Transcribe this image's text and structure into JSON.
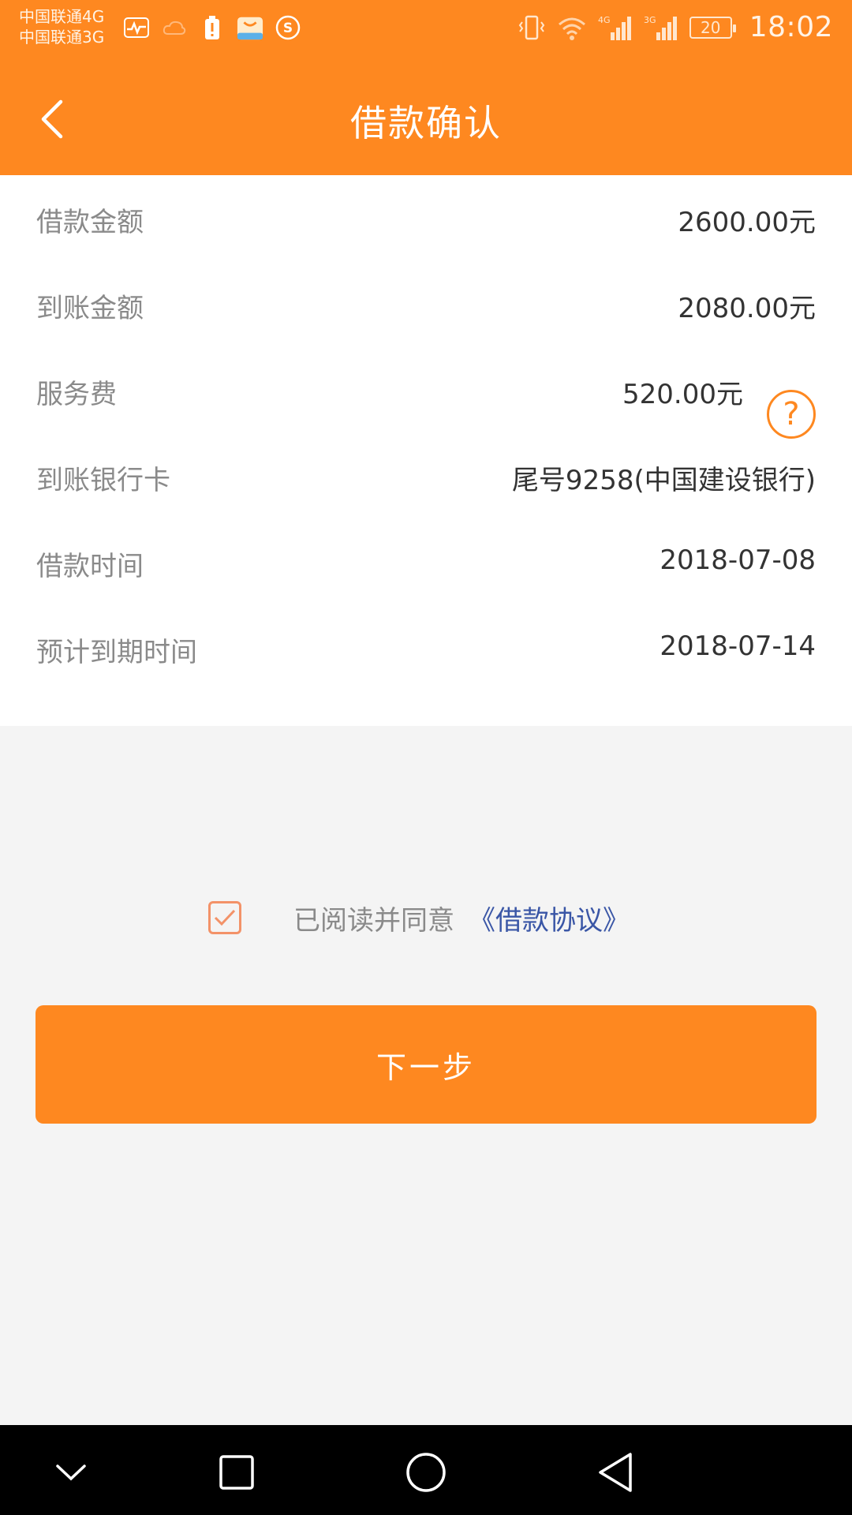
{
  "status_bar": {
    "carrier_line1": "中国联通4G",
    "carrier_line2": "中国联通3G",
    "network1": "4G",
    "network2": "3G",
    "battery": "20",
    "time": "18:02"
  },
  "header": {
    "title": "借款确认"
  },
  "details": [
    {
      "label": "借款金额",
      "value": "2600.00元"
    },
    {
      "label": "到账金额",
      "value": "2080.00元"
    },
    {
      "label": "服务费",
      "value": "520.00元"
    },
    {
      "label": "到账银行卡",
      "value": "尾号9258(中国建设银行)"
    },
    {
      "label": "借款时间",
      "value": "2018-07-08"
    },
    {
      "label": "预计到期时间",
      "value": "2018-07-14"
    }
  ],
  "help_icon": "?",
  "agreement": {
    "checked": true,
    "text": "已阅读并同意",
    "link": "《借款协议》"
  },
  "next_button": "下一步",
  "colors": {
    "brand": "#fe8820",
    "link": "#3a56a6",
    "checkbox": "#f39268"
  },
  "icons": {
    "back": "chevron-left-icon",
    "help": "question-circle-icon",
    "check": "checkmark-icon",
    "nav": [
      "chevron-down-icon",
      "square-icon",
      "circle-icon",
      "triangle-back-icon"
    ]
  }
}
